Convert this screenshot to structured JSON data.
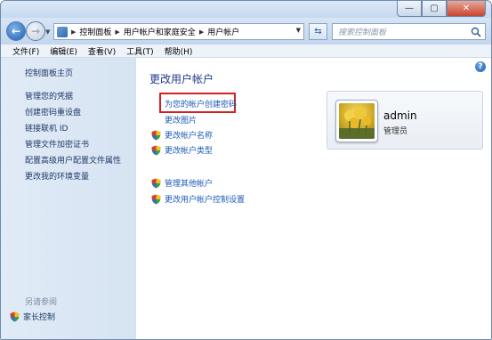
{
  "window": {
    "controls": {
      "minimize": "—",
      "maximize": "▢",
      "close": "✕"
    }
  },
  "navbar": {
    "breadcrumbs": [
      "控制面板",
      "用户帐户和家庭安全",
      "用户帐户"
    ],
    "search_placeholder": "搜索控制面板"
  },
  "menubar": {
    "items": [
      "文件(F)",
      "编辑(E)",
      "查看(V)",
      "工具(T)",
      "帮助(H)"
    ]
  },
  "sidebar": {
    "items": [
      "控制面板主页",
      "管理您的凭据",
      "创建密码重设盘",
      "链接联机 ID",
      "管理文件加密证书",
      "配置高级用户配置文件属性",
      "更改我的环境变量"
    ],
    "see_also_label": "另请参阅",
    "parental_controls": "家长控制"
  },
  "main": {
    "title": "更改用户帐户",
    "links": {
      "create_password": "为您的帐户创建密码",
      "change_picture": "更改图片",
      "change_name": "更改帐户名称",
      "change_type": "更改帐户类型",
      "manage_other": "管理其他帐户",
      "uac_settings": "更改用户帐户控制设置"
    }
  },
  "user": {
    "name": "admin",
    "role": "管理员"
  },
  "colors": {
    "link": "#1a5bb5",
    "title": "#1e3a8a",
    "highlight": "#d42020"
  }
}
